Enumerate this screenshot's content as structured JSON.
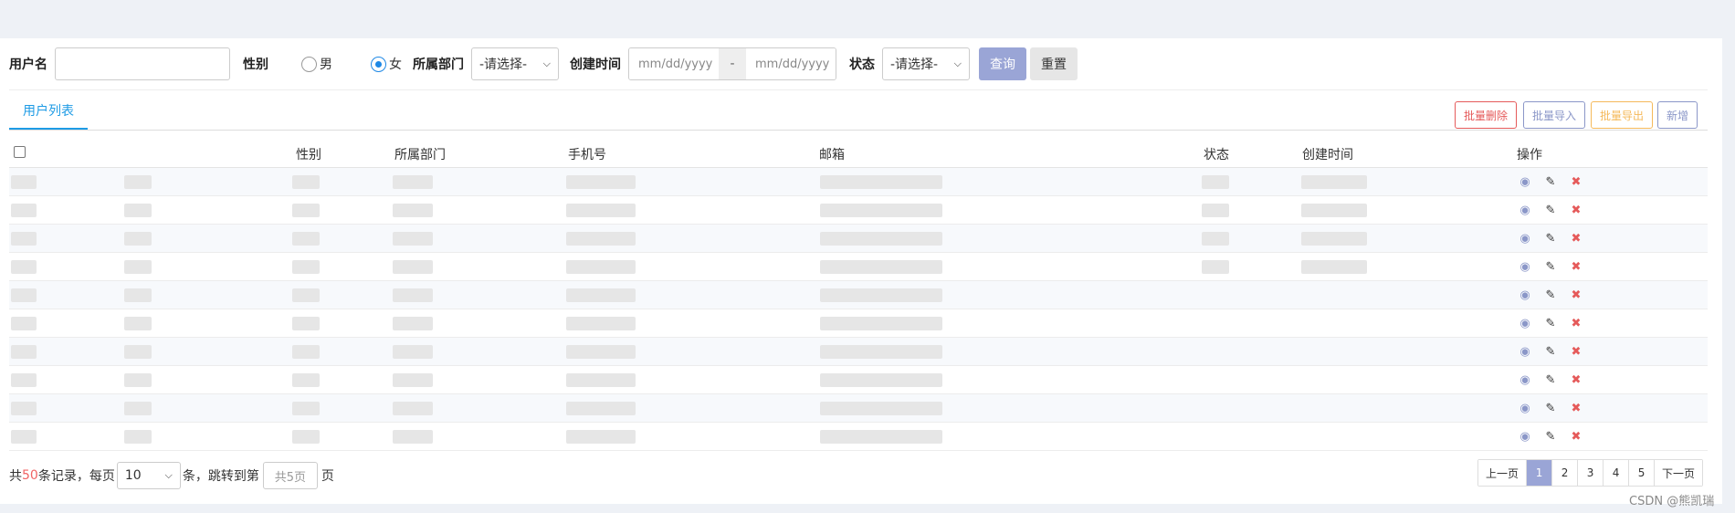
{
  "filters": {
    "username_label": "用户名",
    "username_value": "",
    "gender_label": "性别",
    "gender_options": [
      {
        "label": "男",
        "checked": false
      },
      {
        "label": "女",
        "checked": true
      }
    ],
    "department_label": "所属部门",
    "department_value": "-请选择-",
    "created_label": "创建时间",
    "date_start_placeholder": "mm/dd/yyyy",
    "date_separator": "-",
    "date_end_placeholder": "mm/dd/yyyy",
    "status_label": "状态",
    "status_value": "-请选择-",
    "query_button": "查询",
    "reset_button": "重置"
  },
  "tabs": [
    {
      "label": "用户列表",
      "active": true
    }
  ],
  "actions": {
    "batch_delete": "批量删除",
    "batch_import": "批量导入",
    "batch_export": "批量导出",
    "add": "新增"
  },
  "table": {
    "columns": [
      "性别",
      "所属部门",
      "手机号",
      "邮箱",
      "状态",
      "创建时间",
      "操作"
    ],
    "row_count": 10
  },
  "pagination": {
    "total_prefix": "共",
    "total_count": "50",
    "total_suffix": "条记录，每页",
    "page_size": "10",
    "jump_prefix": "条，跳转到第",
    "jump_placeholder": "共5页",
    "jump_suffix": "页",
    "prev": "上一页",
    "pages": [
      "1",
      "2",
      "3",
      "4",
      "5"
    ],
    "active_page": "1",
    "next": "下一页"
  },
  "watermark": "CSDN @熊凯瑞",
  "colors": {
    "accent": "#1e9be5",
    "primary_button": "#9aa5d6",
    "danger": "#e55a5a",
    "warning": "#f5b95a",
    "info": "#8b97c8"
  },
  "icons": {
    "view": "eye-icon",
    "edit": "pencil-icon",
    "delete": "x-icon"
  }
}
